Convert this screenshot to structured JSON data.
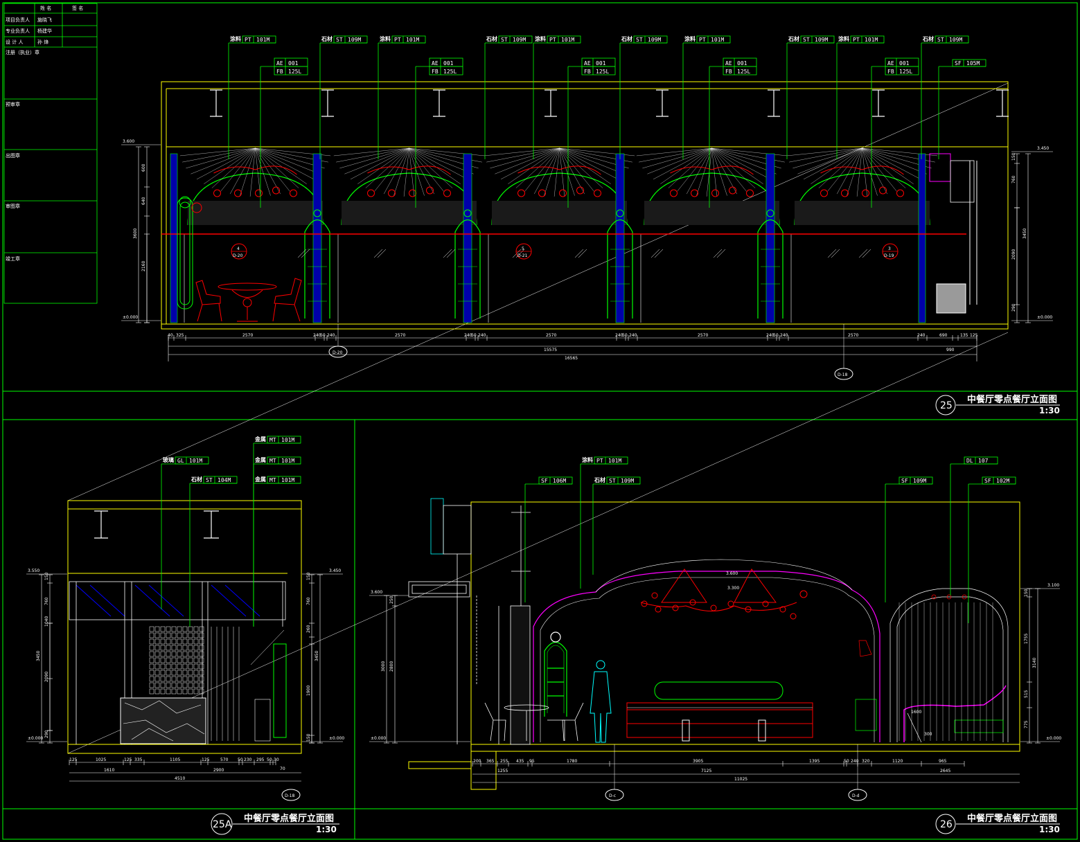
{
  "title_block": {
    "header_name": "姓 名",
    "header_sign": "签 名",
    "rows": [
      {
        "label": "项目负责人",
        "name": "施晓飞"
      },
      {
        "label": "专业负责人",
        "name": "杨建华"
      },
      {
        "label": "设 计 人",
        "name": "孙 烽"
      }
    ],
    "seal_label": "注册（执业）章",
    "boxes": [
      "预审章",
      "出图章",
      "审图章",
      "竣工章"
    ]
  },
  "colors": {
    "frame": "#00ff00",
    "tag": "#00ff00",
    "accent": "#ff0000",
    "line": "#ffffff",
    "glass": "#0000ff",
    "yellow": "#ffff00"
  },
  "drawing25": {
    "number": "25",
    "title": "中餐厅零点餐厅立面图",
    "scale": "1:30",
    "tags": [
      {
        "material": "涂料",
        "code": "PT",
        "num": "101M"
      },
      {
        "material": "石材",
        "code": "ST",
        "num": "109M"
      },
      {
        "material": "涂料",
        "code": "PT",
        "num": "101M"
      },
      {
        "material": "石材",
        "code": "ST",
        "num": "109M"
      },
      {
        "material": "涂料",
        "code": "PT",
        "num": "101M"
      },
      {
        "material": "石材",
        "code": "ST",
        "num": "109M"
      },
      {
        "material": "涂料",
        "code": "PT",
        "num": "101M"
      },
      {
        "material": "石材",
        "code": "ST",
        "num": "109M"
      },
      {
        "material": "涂料",
        "code": "PT",
        "num": "101M"
      },
      {
        "material": "石材",
        "code": "ST",
        "num": "109M"
      }
    ],
    "double_tag": {
      "a_code": "AE",
      "a_num": "001",
      "b_code": "FB",
      "b_num": "125L"
    },
    "sf_tag": {
      "code": "SF",
      "num": "105M"
    },
    "levels": {
      "top_left": "3.600",
      "bottom_left": "±0.000",
      "top_right": "3.450",
      "bottom_right": "±0.000"
    },
    "left_dims": [
      "600",
      "640",
      "3600",
      "2160"
    ],
    "right_dims": [
      "150",
      "760",
      "3450",
      "2090",
      "290"
    ],
    "bottom_dims": [
      "40",
      "325",
      "2570",
      "240",
      "50",
      "240",
      "2570",
      "240",
      "50",
      "240",
      "2570",
      "240",
      "50",
      "240",
      "2570",
      "240",
      "50",
      "240",
      "2570",
      "240",
      "690",
      "135",
      "125"
    ],
    "total1": "15575",
    "total2": "16565",
    "total3": "990",
    "callouts": [
      {
        "num": "4",
        "ref": "D-20"
      },
      {
        "num": "5",
        "ref": "D-21"
      },
      {
        "num": "3",
        "ref": "D-19"
      }
    ],
    "section_refs": [
      "D-20",
      "D-18"
    ]
  },
  "drawing25A": {
    "number": "25A",
    "title": "中餐厅零点餐厅立面图",
    "scale": "1:30",
    "tags": [
      {
        "material": "金属",
        "code": "MT",
        "num": "101M"
      },
      {
        "material": "玻璃",
        "code": "GL",
        "num": "101M"
      },
      {
        "material": "金属",
        "code": "MT",
        "num": "101M"
      },
      {
        "material": "石材",
        "code": "ST",
        "num": "104M"
      },
      {
        "material": "金属",
        "code": "MT",
        "num": "101M"
      }
    ],
    "levels": {
      "top_left": "3.550",
      "bottom_left": "±0.000",
      "top_right": "3.450",
      "bottom_right": "±0.000"
    },
    "left_dims": [
      "150",
      "760",
      "1040",
      "3450",
      "2090",
      "290"
    ],
    "right_dims": [
      "150",
      "760",
      "260",
      "3450",
      "1900",
      "150"
    ],
    "bottom_dims": [
      "125",
      "1025",
      "125",
      "335",
      "1105",
      "125",
      "570",
      "50",
      "230",
      "295",
      "50",
      "30"
    ],
    "sub_dims": [
      "1610",
      "2900",
      "70"
    ],
    "total": "4510",
    "section_ref": "D-18"
  },
  "drawing26": {
    "number": "26",
    "title": "中餐厅零点餐厅立面图",
    "scale": "1:30",
    "tags": [
      {
        "material": "涂料",
        "code": "PT",
        "num": "101M"
      },
      {
        "material": "",
        "code": "SF",
        "num": "106M"
      },
      {
        "material": "石材",
        "code": "ST",
        "num": "109M"
      },
      {
        "material": "",
        "code": "SF",
        "num": "109M"
      },
      {
        "material": "",
        "code": "DL",
        "num": "107"
      },
      {
        "material": "",
        "code": "SF",
        "num": "102M"
      }
    ],
    "levels": {
      "top_left": "3.600",
      "bottom_left": "±0.000",
      "top_right": "3.100",
      "bottom_right": "±0.000",
      "ceiling_1": "3.600",
      "ceiling_2": "3.300"
    },
    "left_dims": [
      "250",
      "3000",
      "2800"
    ],
    "right_dims": [
      "150",
      "1755",
      "3140",
      "515",
      "775"
    ],
    "bottom_dims": [
      "200",
      "365",
      "255",
      "435",
      "95",
      "1780",
      "3905",
      "1395",
      "50",
      "240",
      "320",
      "1120",
      "965"
    ],
    "sub_dims": [
      "1255",
      "7125",
      "2645"
    ],
    "total": "11025",
    "bench_dims": [
      "300",
      "1600"
    ],
    "section_refs": [
      "D-c",
      "D-d"
    ]
  }
}
